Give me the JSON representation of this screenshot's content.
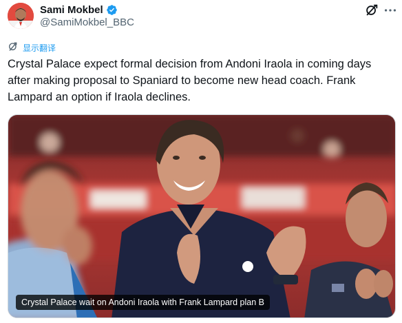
{
  "author": {
    "display_name": "Sami Mokbel",
    "handle": "@SamiMokbel_BBC",
    "verified": true
  },
  "actions": {
    "grok_icon": "grok-icon",
    "more_icon": "more-icon"
  },
  "translate": {
    "label": "显示翻译"
  },
  "tweet": {
    "text": "Crystal Palace expect formal decision from Andoni Iraola in coming days after making proposal to Spaniard to become new head coach. Frank Lampard an option if Iraola declines."
  },
  "media": {
    "caption": "Crystal Palace wait on Andoni Iraola with Frank Lampard plan B"
  },
  "colors": {
    "accent": "#1d9bf0",
    "text": "#0f1419",
    "secondary": "#536471"
  }
}
